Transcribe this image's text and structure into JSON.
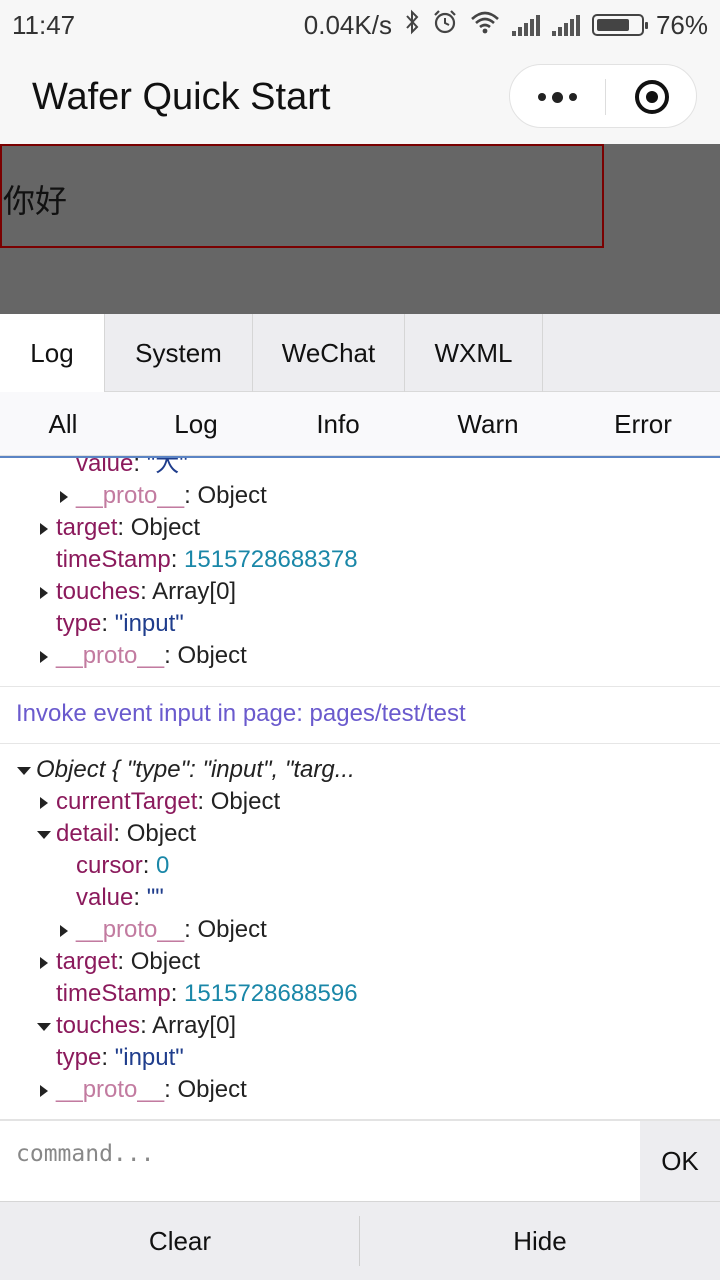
{
  "status_bar": {
    "time": "11:47",
    "net_speed": "0.04K/s",
    "battery_percent": "76%",
    "battery_level": 0.76,
    "icons": [
      "bluetooth-icon",
      "alarm-icon",
      "wifi-icon",
      "signal-icon",
      "signal-icon",
      "battery-icon"
    ]
  },
  "navbar": {
    "title": "Wafer Quick Start",
    "icons": [
      "more-icon",
      "close-target-icon"
    ]
  },
  "page": {
    "input_text": "你好",
    "colors": {
      "background": "#666666",
      "input_border": "#7a0000"
    }
  },
  "console": {
    "tabs": [
      "Log",
      "System",
      "WeChat",
      "WXML"
    ],
    "active_tab": "Log",
    "filters": [
      "All",
      "Log",
      "Info",
      "Warn",
      "Error"
    ],
    "partial_entry": {
      "value_line_key": "value",
      "value_line_val": "\"大\"",
      "proto_nested": "__proto__",
      "proto_nested_val": "Object",
      "target_key": "target",
      "target_val": "Object",
      "timestamp_key": "timeStamp",
      "timestamp_val": "1515728688378",
      "touches_key": "touches",
      "touches_val": "Array[0]",
      "type_key": "type",
      "type_val": "\"input\"",
      "proto_key": "__proto__",
      "proto_val": "Object"
    },
    "info_message": "Invoke event input in page: pages/test/test",
    "entry": {
      "summary": "Object { \"type\": \"input\", \"targ...",
      "currentTarget_key": "currentTarget",
      "currentTarget_val": "Object",
      "detail_key": "detail",
      "detail_val": "Object",
      "cursor_key": "cursor",
      "cursor_val": "0",
      "value_key": "value",
      "value_val": "\"\"",
      "proto_nested": "__proto__",
      "proto_nested_val": "Object",
      "target_key": "target",
      "target_val": "Object",
      "timestamp_key": "timeStamp",
      "timestamp_val": "1515728688596",
      "touches_key": "touches",
      "touches_val": "Array[0]",
      "type_key": "type",
      "type_val": "\"input\"",
      "proto_key": "__proto__",
      "proto_val": "Object"
    },
    "command_placeholder": "command...",
    "ok_label": "OK",
    "clear_label": "Clear",
    "hide_label": "Hide"
  }
}
